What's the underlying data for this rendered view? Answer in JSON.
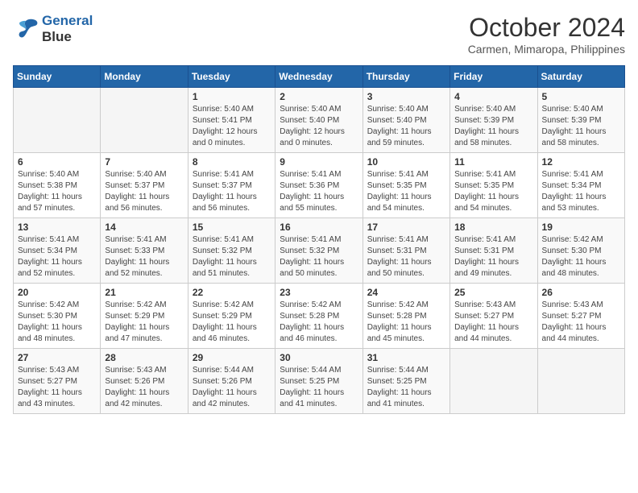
{
  "header": {
    "logo_line1": "General",
    "logo_line2": "Blue",
    "month": "October 2024",
    "location": "Carmen, Mimaropa, Philippines"
  },
  "days_of_week": [
    "Sunday",
    "Monday",
    "Tuesday",
    "Wednesday",
    "Thursday",
    "Friday",
    "Saturday"
  ],
  "weeks": [
    [
      {
        "day": "",
        "info": ""
      },
      {
        "day": "",
        "info": ""
      },
      {
        "day": "1",
        "info": "Sunrise: 5:40 AM\nSunset: 5:41 PM\nDaylight: 12 hours\nand 0 minutes."
      },
      {
        "day": "2",
        "info": "Sunrise: 5:40 AM\nSunset: 5:40 PM\nDaylight: 12 hours\nand 0 minutes."
      },
      {
        "day": "3",
        "info": "Sunrise: 5:40 AM\nSunset: 5:40 PM\nDaylight: 11 hours\nand 59 minutes."
      },
      {
        "day": "4",
        "info": "Sunrise: 5:40 AM\nSunset: 5:39 PM\nDaylight: 11 hours\nand 58 minutes."
      },
      {
        "day": "5",
        "info": "Sunrise: 5:40 AM\nSunset: 5:39 PM\nDaylight: 11 hours\nand 58 minutes."
      }
    ],
    [
      {
        "day": "6",
        "info": "Sunrise: 5:40 AM\nSunset: 5:38 PM\nDaylight: 11 hours\nand 57 minutes."
      },
      {
        "day": "7",
        "info": "Sunrise: 5:40 AM\nSunset: 5:37 PM\nDaylight: 11 hours\nand 56 minutes."
      },
      {
        "day": "8",
        "info": "Sunrise: 5:41 AM\nSunset: 5:37 PM\nDaylight: 11 hours\nand 56 minutes."
      },
      {
        "day": "9",
        "info": "Sunrise: 5:41 AM\nSunset: 5:36 PM\nDaylight: 11 hours\nand 55 minutes."
      },
      {
        "day": "10",
        "info": "Sunrise: 5:41 AM\nSunset: 5:35 PM\nDaylight: 11 hours\nand 54 minutes."
      },
      {
        "day": "11",
        "info": "Sunrise: 5:41 AM\nSunset: 5:35 PM\nDaylight: 11 hours\nand 54 minutes."
      },
      {
        "day": "12",
        "info": "Sunrise: 5:41 AM\nSunset: 5:34 PM\nDaylight: 11 hours\nand 53 minutes."
      }
    ],
    [
      {
        "day": "13",
        "info": "Sunrise: 5:41 AM\nSunset: 5:34 PM\nDaylight: 11 hours\nand 52 minutes."
      },
      {
        "day": "14",
        "info": "Sunrise: 5:41 AM\nSunset: 5:33 PM\nDaylight: 11 hours\nand 52 minutes."
      },
      {
        "day": "15",
        "info": "Sunrise: 5:41 AM\nSunset: 5:32 PM\nDaylight: 11 hours\nand 51 minutes."
      },
      {
        "day": "16",
        "info": "Sunrise: 5:41 AM\nSunset: 5:32 PM\nDaylight: 11 hours\nand 50 minutes."
      },
      {
        "day": "17",
        "info": "Sunrise: 5:41 AM\nSunset: 5:31 PM\nDaylight: 11 hours\nand 50 minutes."
      },
      {
        "day": "18",
        "info": "Sunrise: 5:41 AM\nSunset: 5:31 PM\nDaylight: 11 hours\nand 49 minutes."
      },
      {
        "day": "19",
        "info": "Sunrise: 5:42 AM\nSunset: 5:30 PM\nDaylight: 11 hours\nand 48 minutes."
      }
    ],
    [
      {
        "day": "20",
        "info": "Sunrise: 5:42 AM\nSunset: 5:30 PM\nDaylight: 11 hours\nand 48 minutes."
      },
      {
        "day": "21",
        "info": "Sunrise: 5:42 AM\nSunset: 5:29 PM\nDaylight: 11 hours\nand 47 minutes."
      },
      {
        "day": "22",
        "info": "Sunrise: 5:42 AM\nSunset: 5:29 PM\nDaylight: 11 hours\nand 46 minutes."
      },
      {
        "day": "23",
        "info": "Sunrise: 5:42 AM\nSunset: 5:28 PM\nDaylight: 11 hours\nand 46 minutes."
      },
      {
        "day": "24",
        "info": "Sunrise: 5:42 AM\nSunset: 5:28 PM\nDaylight: 11 hours\nand 45 minutes."
      },
      {
        "day": "25",
        "info": "Sunrise: 5:43 AM\nSunset: 5:27 PM\nDaylight: 11 hours\nand 44 minutes."
      },
      {
        "day": "26",
        "info": "Sunrise: 5:43 AM\nSunset: 5:27 PM\nDaylight: 11 hours\nand 44 minutes."
      }
    ],
    [
      {
        "day": "27",
        "info": "Sunrise: 5:43 AM\nSunset: 5:27 PM\nDaylight: 11 hours\nand 43 minutes."
      },
      {
        "day": "28",
        "info": "Sunrise: 5:43 AM\nSunset: 5:26 PM\nDaylight: 11 hours\nand 42 minutes."
      },
      {
        "day": "29",
        "info": "Sunrise: 5:44 AM\nSunset: 5:26 PM\nDaylight: 11 hours\nand 42 minutes."
      },
      {
        "day": "30",
        "info": "Sunrise: 5:44 AM\nSunset: 5:25 PM\nDaylight: 11 hours\nand 41 minutes."
      },
      {
        "day": "31",
        "info": "Sunrise: 5:44 AM\nSunset: 5:25 PM\nDaylight: 11 hours\nand 41 minutes."
      },
      {
        "day": "",
        "info": ""
      },
      {
        "day": "",
        "info": ""
      }
    ]
  ]
}
